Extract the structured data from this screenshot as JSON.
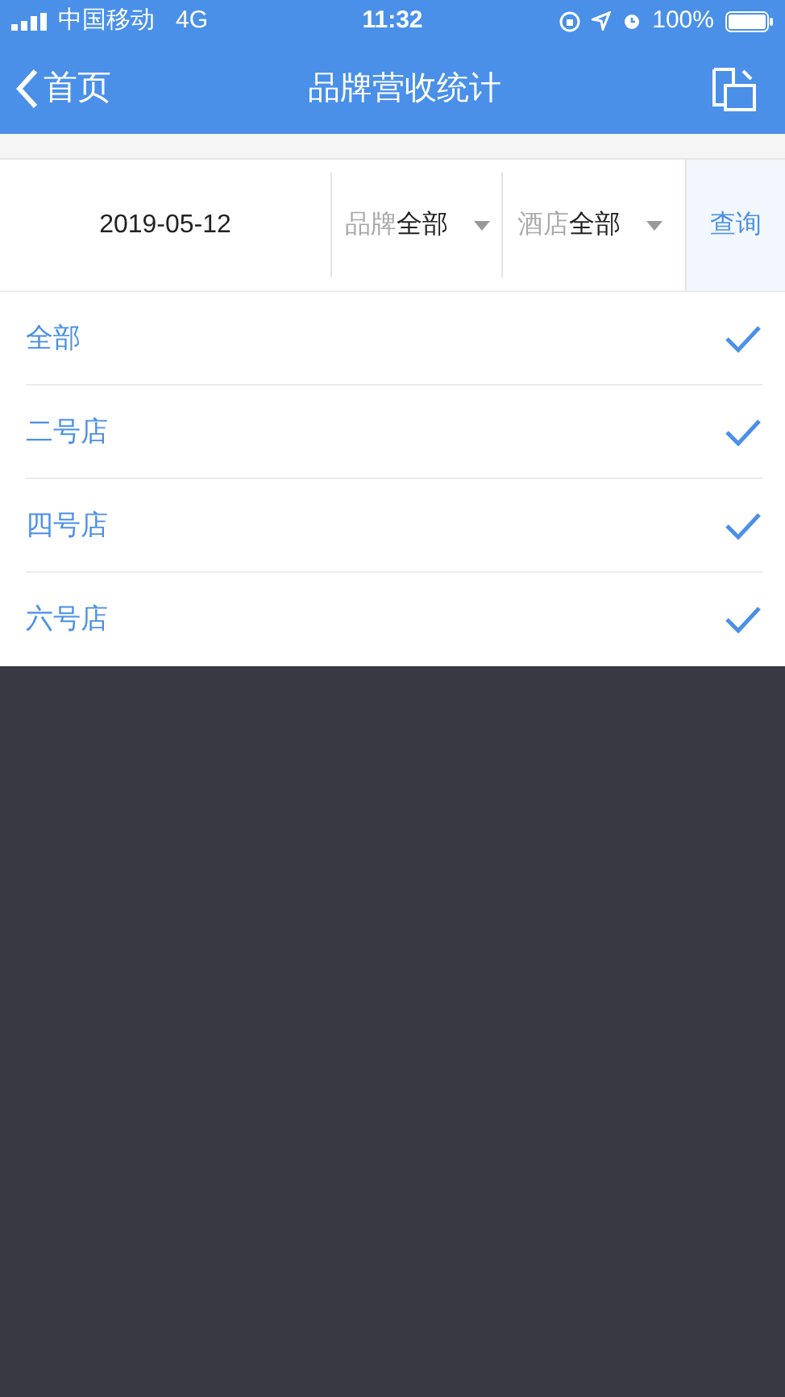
{
  "status_bar": {
    "carrier": "中国移动",
    "network": "4G",
    "time": "11:32",
    "battery": "100%"
  },
  "nav_bar": {
    "back_label": "首页",
    "title": "品牌营收统计"
  },
  "filter": {
    "date": "2019-05-12",
    "brand": {
      "label": "品牌",
      "value": "全部"
    },
    "hotel": {
      "label": "酒店",
      "value": "全部"
    },
    "query_button": "查询"
  },
  "options": [
    {
      "label": "全部",
      "checked": true
    },
    {
      "label": "二号店",
      "checked": true
    },
    {
      "label": "四号店",
      "checked": true
    },
    {
      "label": "六号店",
      "checked": true
    }
  ]
}
